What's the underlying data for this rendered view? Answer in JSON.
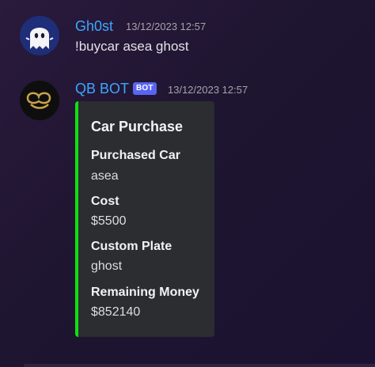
{
  "messages": [
    {
      "username": "Gh0st",
      "timestamp": "13/12/2023 12:57",
      "content": "!buycar asea ghost",
      "avatar_icon": "ghost-avatar-icon"
    },
    {
      "username": "QB BOT",
      "badge": "BOT",
      "timestamp": "13/12/2023 12:57",
      "avatar_icon": "qb-logo-avatar-icon",
      "embed": {
        "accent_color": "#10e010",
        "title": "Car Purchase",
        "fields": [
          {
            "name": "Purchased Car",
            "value": "asea"
          },
          {
            "name": "Cost",
            "value": "$5500"
          },
          {
            "name": "Custom Plate",
            "value": "ghost"
          },
          {
            "name": "Remaining Money",
            "value": "$852140"
          }
        ]
      }
    }
  ],
  "colors": {
    "username": "#3ea6ff",
    "bot_badge": "#5865f2",
    "embed_background": "#2b2d31",
    "timestamp": "#a6a3ad"
  }
}
